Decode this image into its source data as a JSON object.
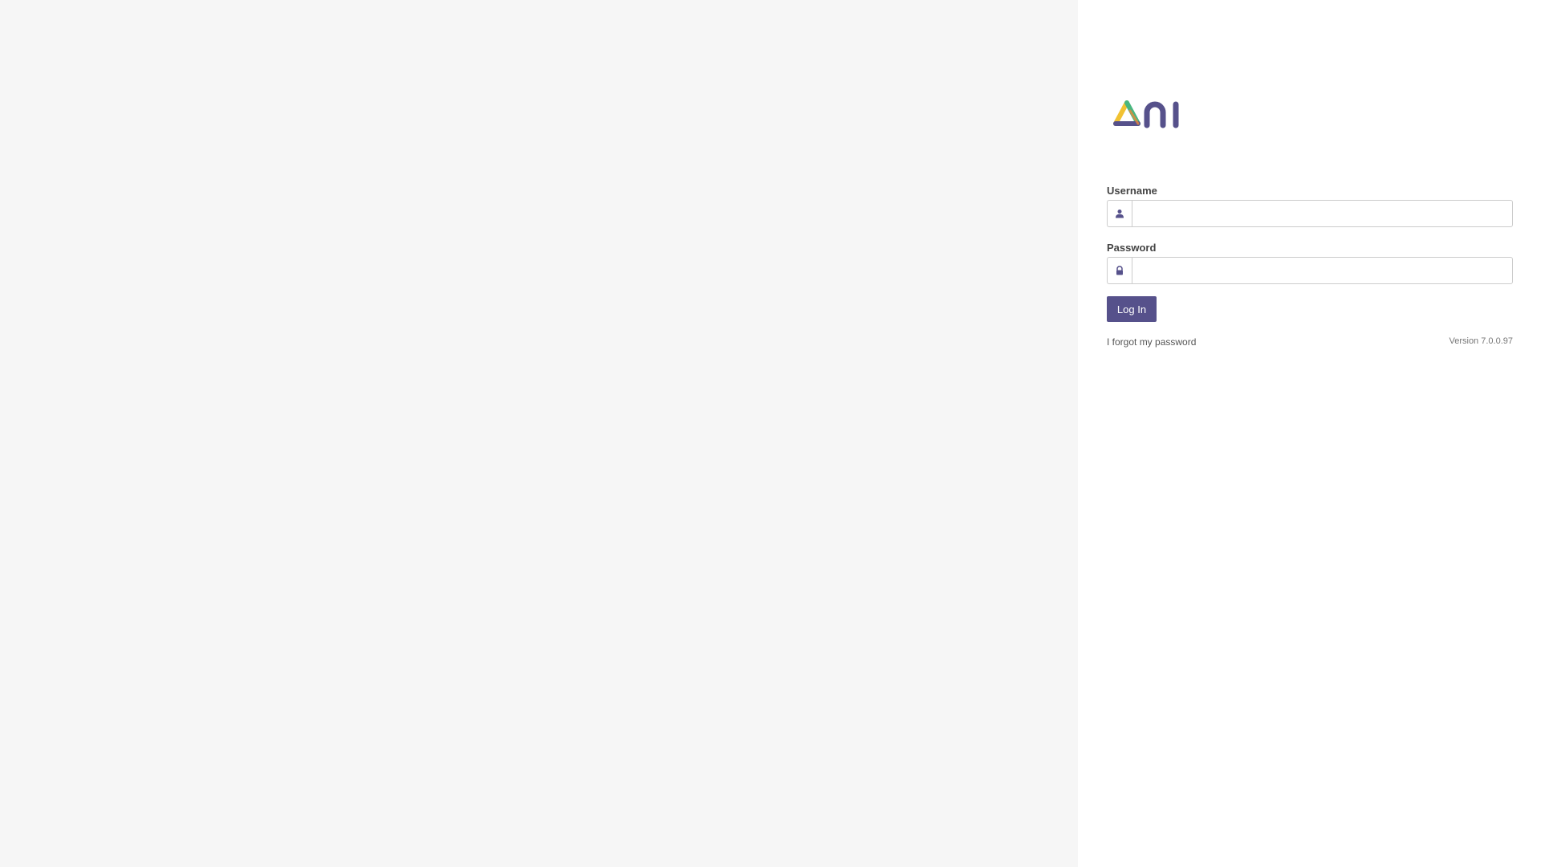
{
  "brand": {
    "logo_name": "ani-logo",
    "colors": {
      "primary": "#56518b",
      "logo_green": "#49b67f",
      "logo_yellow": "#f1c232",
      "logo_orange": "#ea8a3b",
      "logo_purple": "#56518b"
    }
  },
  "form": {
    "username_label": "Username",
    "username_value": "",
    "username_icon": "user-icon",
    "password_label": "Password",
    "password_value": "",
    "password_icon": "lock-icon",
    "login_label": "Log In"
  },
  "footer": {
    "forgot_label": "I forgot my password",
    "version": "Version 7.0.0.97"
  }
}
